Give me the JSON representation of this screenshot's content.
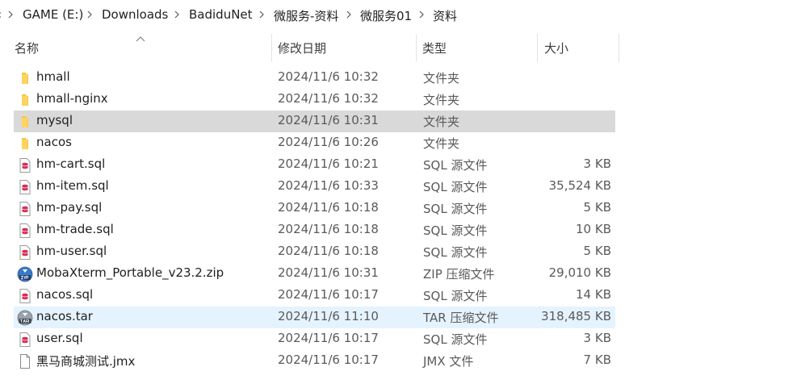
{
  "breadcrumb": {
    "leading_fragment": "‹",
    "items": [
      "GAME (E:)",
      "Downloads",
      "BadiduNet",
      "微服务-资料",
      "微服务01",
      "资料"
    ]
  },
  "columns": {
    "name": "名称",
    "date": "修改日期",
    "type": "类型",
    "size": "大小"
  },
  "files": [
    {
      "name": "hmall",
      "date": "2024/11/6 10:32",
      "type": "文件夹",
      "size": "",
      "icon": "folder-icon"
    },
    {
      "name": "hmall-nginx",
      "date": "2024/11/6 10:32",
      "type": "文件夹",
      "size": "",
      "icon": "folder-icon"
    },
    {
      "name": "mysql",
      "date": "2024/11/6 10:31",
      "type": "文件夹",
      "size": "",
      "icon": "folder-icon"
    },
    {
      "name": "nacos",
      "date": "2024/11/6 10:26",
      "type": "文件夹",
      "size": "",
      "icon": "folder-icon"
    },
    {
      "name": "hm-cart.sql",
      "date": "2024/11/6 10:21",
      "type": "SQL 源文件",
      "size": "3 KB",
      "icon": "sql-file-icon"
    },
    {
      "name": "hm-item.sql",
      "date": "2024/11/6 10:33",
      "type": "SQL 源文件",
      "size": "35,524 KB",
      "icon": "sql-file-icon"
    },
    {
      "name": "hm-pay.sql",
      "date": "2024/11/6 10:18",
      "type": "SQL 源文件",
      "size": "5 KB",
      "icon": "sql-file-icon"
    },
    {
      "name": "hm-trade.sql",
      "date": "2024/11/6 10:18",
      "type": "SQL 源文件",
      "size": "10 KB",
      "icon": "sql-file-icon"
    },
    {
      "name": "hm-user.sql",
      "date": "2024/11/6 10:18",
      "type": "SQL 源文件",
      "size": "5 KB",
      "icon": "sql-file-icon"
    },
    {
      "name": "MobaXterm_Portable_v23.2.zip",
      "date": "2024/11/6 10:31",
      "type": "ZIP 压缩文件",
      "size": "29,010 KB",
      "icon": "zip-archive-icon"
    },
    {
      "name": "nacos.sql",
      "date": "2024/11/6 10:17",
      "type": "SQL 源文件",
      "size": "14 KB",
      "icon": "sql-file-icon"
    },
    {
      "name": "nacos.tar",
      "date": "2024/11/6 11:10",
      "type": "TAR 压缩文件",
      "size": "318,485 KB",
      "icon": "tar-archive-icon"
    },
    {
      "name": "user.sql",
      "date": "2024/11/6 10:17",
      "type": "SQL 源文件",
      "size": "3 KB",
      "icon": "sql-file-icon"
    },
    {
      "name": "黑马商城测试.jmx",
      "date": "2024/11/6 10:17",
      "type": "JMX 文件",
      "size": "7 KB",
      "icon": "blank-file-icon"
    }
  ],
  "colors": {
    "selected_row": "#d9d9d9",
    "hover_row": "#e5f3ff",
    "folder": "#f8c640"
  }
}
